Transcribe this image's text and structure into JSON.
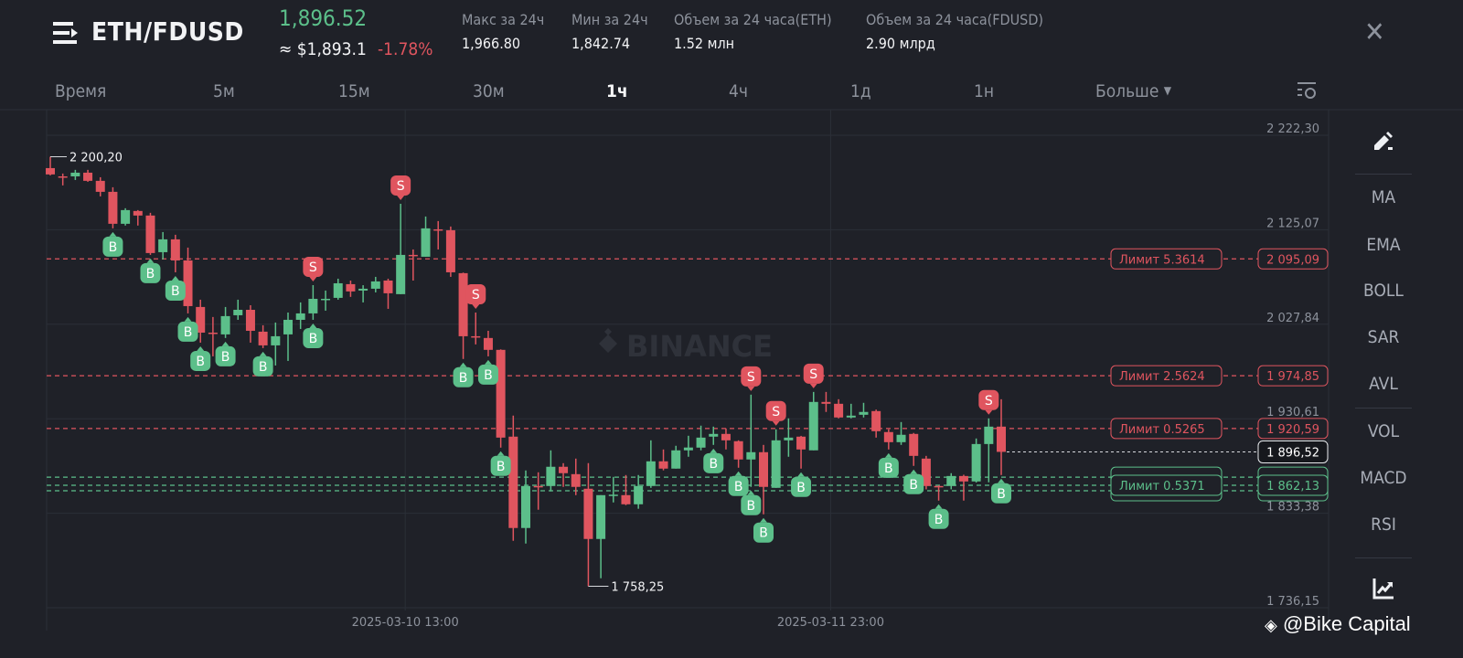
{
  "header": {
    "pair": "ETH/FDUSD",
    "last_price": "1,896.52",
    "usd_price": "≈ $1,893.1",
    "change": "-1.78%",
    "stats": [
      {
        "label": "Макс за 24ч",
        "value": "1,966.80"
      },
      {
        "label": "Мин за 24ч",
        "value": "1,842.74"
      },
      {
        "label": "Объем за 24 часа(ETH)",
        "value": "1.52 млн"
      },
      {
        "label": "Объем за 24 часа(FDUSD)",
        "value": "2.90 млрд"
      }
    ],
    "close_icon": "close-icon",
    "menu_icon": "menu-icon"
  },
  "tabs": {
    "items": [
      "Время",
      "5м",
      "15м",
      "30м",
      "1ч",
      "4ч",
      "1д",
      "1н"
    ],
    "active": "1ч",
    "more": "Больше",
    "settings_icon": "chart-settings-icon"
  },
  "sidebar": {
    "draw_icon": "pencil-icon",
    "indicators": [
      "MA",
      "EMA",
      "BOLL",
      "SAR",
      "AVL",
      "VOL",
      "MACD",
      "RSI"
    ],
    "chart_icon": "chart-line-icon"
  },
  "watermark": {
    "brand": "BINANCE",
    "credit": "@Bike Capital"
  },
  "colors": {
    "up": "#5cbf8a",
    "down": "#e0555f",
    "bg": "#1f2128",
    "grid": "#2b2f37"
  },
  "chart_data": {
    "type": "candlestick",
    "interval": "1ч",
    "ylim": [
      1736.15,
      2222.3
    ],
    "y_ticks": [
      "2 222,30",
      "2 125,07",
      "2 027,84",
      "1 930,61",
      "1 833,38",
      "1 736,15"
    ],
    "y_tick_values": [
      2222.3,
      2125.07,
      2027.84,
      1930.61,
      1833.38,
      1736.15
    ],
    "x_labels": [
      {
        "label": "2025-03-10 13:00",
        "index": 29
      },
      {
        "label": "2025-03-11 23:00",
        "index": 63
      }
    ],
    "max_label": {
      "text": "2 200,20",
      "value": 2200.2,
      "index": 1
    },
    "min_label": {
      "text": "1 758,25",
      "value": 1758.25,
      "index": 44
    },
    "current_price": {
      "text": "1 896,52",
      "value": 1896.52
    },
    "limit_orders": [
      {
        "side": "sell",
        "label": "Лимит  5.3614",
        "price_text": "2 095,09",
        "price": 2095.09
      },
      {
        "side": "sell",
        "label": "Лимит  2.5624",
        "price_text": "1 974,85",
        "price": 1974.85
      },
      {
        "side": "sell",
        "label": "Лимит  0.5265",
        "price_text": "1 920,59",
        "price": 1920.59
      },
      {
        "side": "buy",
        "label": "Лимит  0.5371",
        "price_text": "1 862,13",
        "price": 1862.13
      }
    ],
    "stacked_buy_order_prices": [
      1870.5,
      1856.5
    ],
    "candles": [
      [
        2188.5,
        2200.2,
        2181.0,
        2182.0
      ],
      [
        2180.0,
        2182.9,
        2170.7,
        2179.1
      ],
      [
        2180.0,
        2186.7,
        2176.3,
        2183.8
      ],
      [
        2183.8,
        2186.7,
        2174.4,
        2175.4
      ],
      [
        2175.4,
        2179.1,
        2159.4,
        2164.1
      ],
      [
        2164.1,
        2168.8,
        2126.5,
        2131.2
      ],
      [
        2131.2,
        2147.2,
        2129.4,
        2145.3
      ],
      [
        2144.4,
        2145.3,
        2129.4,
        2139.7
      ],
      [
        2139.7,
        2142.5,
        2099.2,
        2101.1
      ],
      [
        2102.0,
        2122.7,
        2094.5,
        2115.2
      ],
      [
        2115.2,
        2119.9,
        2081.3,
        2093.5
      ],
      [
        2093.5,
        2106.7,
        2039.0,
        2046.5
      ],
      [
        2045.6,
        2053.1,
        2008.9,
        2019.2
      ],
      [
        2019.2,
        2035.3,
        1994.8,
        2018.3
      ],
      [
        2017.4,
        2045.6,
        2013.7,
        2036.2
      ],
      [
        2037.1,
        2053.1,
        2032.4,
        2042.7
      ],
      [
        2042.7,
        2047.4,
        2008.9,
        2021.1
      ],
      [
        2020.2,
        2026.8,
        2003.3,
        2006.1
      ],
      [
        2006.1,
        2029.6,
        1985.4,
        2015.5
      ],
      [
        2017.4,
        2039.9,
        1990.1,
        2032.4
      ],
      [
        2032.4,
        2050.3,
        2023.0,
        2039.0
      ],
      [
        2039.0,
        2068.1,
        2032.4,
        2054.0
      ],
      [
        2053.1,
        2062.5,
        2041.8,
        2054.0
      ],
      [
        2055.0,
        2074.7,
        2053.1,
        2070.0
      ],
      [
        2069.1,
        2072.8,
        2056.0,
        2061.6
      ],
      [
        2062.5,
        2068.0,
        2050.3,
        2064.4
      ],
      [
        2064.4,
        2076.6,
        2060.6,
        2071.9
      ],
      [
        2072.8,
        2074.7,
        2043.7,
        2059.7
      ],
      [
        2058.8,
        2151.8,
        2058.8,
        2099.2
      ],
      [
        2099.2,
        2104.8,
        2072.8,
        2098.3
      ],
      [
        2097.3,
        2138.7,
        2097.3,
        2126.5
      ],
      [
        2125.5,
        2134.0,
        2104.8,
        2124.6
      ],
      [
        2124.6,
        2128.4,
        2076.6,
        2081.3
      ],
      [
        2080.4,
        2081.0,
        1992.1,
        2015.5
      ],
      [
        2015.5,
        2039.9,
        2007.1,
        2014.6
      ],
      [
        2013.7,
        2021.1,
        1994.8,
        2001.5
      ],
      [
        2001.5,
        2002.0,
        1900.9,
        1911.2
      ],
      [
        1912.2,
        1933.8,
        1805.0,
        1818.2
      ],
      [
        1818.2,
        1877.4,
        1802.2,
        1861.4
      ],
      [
        1861.4,
        1875.5,
        1837.0,
        1860.5
      ],
      [
        1861.4,
        1898.1,
        1855.8,
        1881.2
      ],
      [
        1881.2,
        1884.9,
        1860.5,
        1874.6
      ],
      [
        1873.6,
        1889.6,
        1852.0,
        1860.5
      ],
      [
        1858.6,
        1884.9,
        1758.25,
        1806.9
      ],
      [
        1806.9,
        1852.0,
        1766.5,
        1852.0
      ],
      [
        1852.0,
        1870.8,
        1844.5,
        1852.5
      ],
      [
        1852.0,
        1872.7,
        1841.7,
        1842.6
      ],
      [
        1842.6,
        1872.7,
        1838.0,
        1861.4
      ],
      [
        1861.4,
        1908.4,
        1859.5,
        1886.8
      ],
      [
        1886.8,
        1899.0,
        1877.5,
        1879.3
      ],
      [
        1879.3,
        1902.8,
        1879.3,
        1898.1
      ],
      [
        1898.1,
        1913.1,
        1891.5,
        1901.0
      ],
      [
        1900.9,
        1923.5,
        1898.1,
        1911.2
      ],
      [
        1912.2,
        1922.5,
        1903.7,
        1915.0
      ],
      [
        1915.0,
        1920.6,
        1899.0,
        1908.4
      ],
      [
        1907.5,
        1908.4,
        1880.2,
        1888.7
      ],
      [
        1888.7,
        1955.4,
        1860.5,
        1896.2
      ],
      [
        1896.2,
        1903.7,
        1832.3,
        1860.5
      ],
      [
        1859.5,
        1919.7,
        1859.5,
        1908.4
      ],
      [
        1908.4,
        1931.0,
        1891.5,
        1911.2
      ],
      [
        1912.2,
        1913.0,
        1879.3,
        1899.0
      ],
      [
        1898.1,
        1958.2,
        1898.1,
        1947.9
      ],
      [
        1947.9,
        1958.2,
        1937.6,
        1946.0
      ],
      [
        1946.0,
        1950.7,
        1931.0,
        1931.9
      ],
      [
        1931.9,
        1946.0,
        1931.0,
        1933.8
      ],
      [
        1934.7,
        1947.0,
        1931.9,
        1937.6
      ],
      [
        1938.5,
        1940.0,
        1911.2,
        1917.8
      ],
      [
        1916.9,
        1919.7,
        1899.0,
        1906.5
      ],
      [
        1906.5,
        1927.2,
        1903.7,
        1914.1
      ],
      [
        1915.0,
        1916.0,
        1882.1,
        1892.4
      ],
      [
        1889.6,
        1892.4,
        1858.0,
        1861.4
      ],
      [
        1861.4,
        1862.0,
        1846.4,
        1860.5
      ],
      [
        1861.4,
        1874.6,
        1858.0,
        1871.7
      ],
      [
        1871.7,
        1873.0,
        1846.4,
        1866.1
      ],
      [
        1866.1,
        1910.3,
        1865.0,
        1904.6
      ],
      [
        1904.6,
        1931.0,
        1865.2,
        1922.5
      ],
      [
        1922.5,
        1950.7,
        1872.7,
        1896.52
      ]
    ],
    "trade_markers": [
      {
        "index": 6,
        "type": "B"
      },
      {
        "index": 9,
        "type": "B"
      },
      {
        "index": 11,
        "type": "B"
      },
      {
        "index": 12,
        "type": "B"
      },
      {
        "index": 13,
        "type": "B"
      },
      {
        "index": 15,
        "type": "B"
      },
      {
        "index": 18,
        "type": "B"
      },
      {
        "index": 22,
        "type": "B"
      },
      {
        "index": 22,
        "type": "S"
      },
      {
        "index": 29,
        "type": "S"
      },
      {
        "index": 34,
        "type": "B"
      },
      {
        "index": 35,
        "type": "S"
      },
      {
        "index": 36,
        "type": "B"
      },
      {
        "index": 37,
        "type": "B"
      },
      {
        "index": 54,
        "type": "B"
      },
      {
        "index": 56,
        "type": "B"
      },
      {
        "index": 57,
        "type": "B"
      },
      {
        "index": 57,
        "type": "S"
      },
      {
        "index": 58,
        "type": "B"
      },
      {
        "index": 59,
        "type": "S"
      },
      {
        "index": 61,
        "type": "B"
      },
      {
        "index": 62,
        "type": "S"
      },
      {
        "index": 68,
        "type": "B"
      },
      {
        "index": 70,
        "type": "B"
      },
      {
        "index": 72,
        "type": "B"
      },
      {
        "index": 76,
        "type": "S"
      },
      {
        "index": 77,
        "type": "B"
      }
    ]
  }
}
